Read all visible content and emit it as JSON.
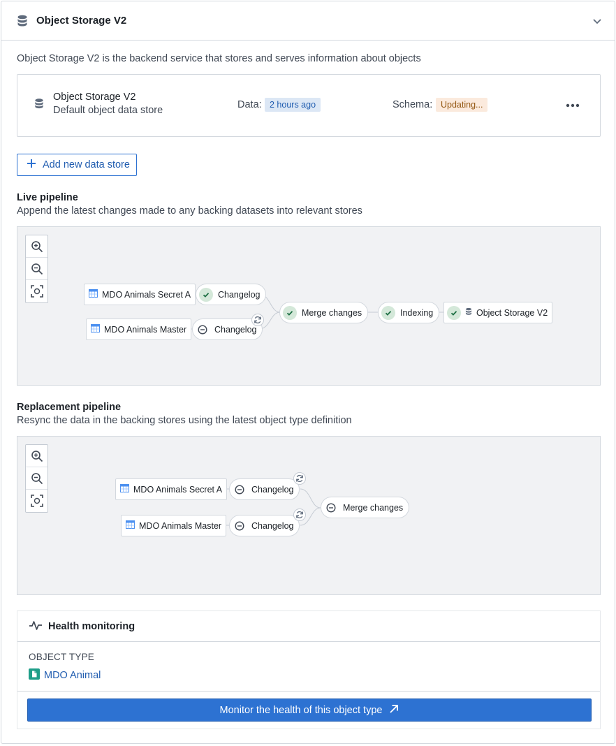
{
  "header": {
    "title": "Object Storage V2"
  },
  "description": "Object Storage V2 is the backend service that stores and serves information about objects",
  "store": {
    "name": "Object Storage V2",
    "subtitle": "Default object data store",
    "data_label": "Data:",
    "data_value": "2 hours ago",
    "schema_label": "Schema:",
    "schema_value": "Updating..."
  },
  "add_button": "Add new data store",
  "live": {
    "title": "Live pipeline",
    "description": "Append the latest changes made to any backing datasets into relevant stores",
    "nodes": {
      "source_a": "MDO Animals Secret A",
      "source_b": "MDO Animals Master",
      "changelog_a": "Changelog",
      "changelog_b": "Changelog",
      "merge": "Merge changes",
      "indexing": "Indexing",
      "sink": "Object Storage V2"
    }
  },
  "replacement": {
    "title": "Replacement pipeline",
    "description": "Resync the data in the backing stores using the latest object type definition",
    "nodes": {
      "source_a": "MDO Animals Secret A",
      "source_b": "MDO Animals Master",
      "changelog_a": "Changelog",
      "changelog_b": "Changelog",
      "merge": "Merge changes"
    }
  },
  "health": {
    "title": "Health monitoring",
    "object_type_label": "OBJECT TYPE",
    "object_type_value": "MDO Animal",
    "monitor_button": "Monitor the health of this object type"
  },
  "colors": {
    "accent": "#2d72d2",
    "success": "#238551",
    "warning": "#935610"
  }
}
